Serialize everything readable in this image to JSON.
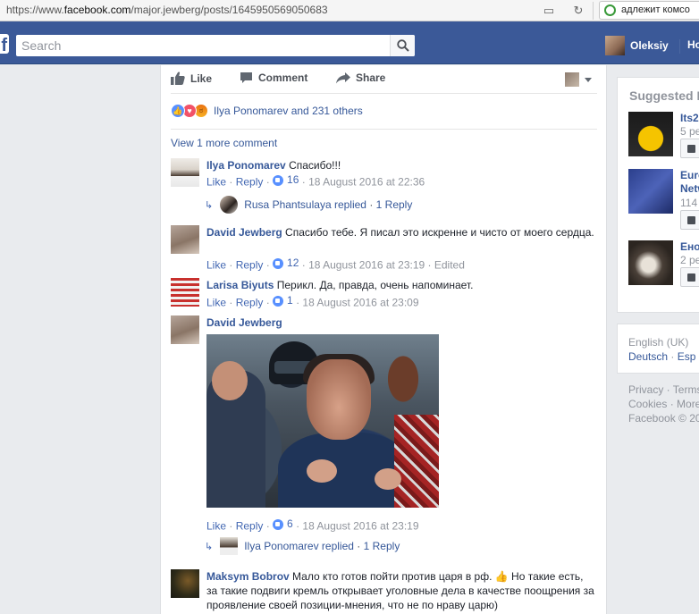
{
  "browser": {
    "url_prefix": "https://www.",
    "url_host": "facebook.com",
    "url_path": "/major.jewberg/posts/1645950569050683",
    "search_text": "адлежит комсо"
  },
  "topbar": {
    "search_placeholder": "Search",
    "user_name": "Oleksiy",
    "home_label": "Ho"
  },
  "post": {
    "actions": {
      "like": "Like",
      "comment": "Comment",
      "share": "Share"
    },
    "reactions_text": "Ilya Ponomarev and 231 others",
    "more_comments": "View 1 more comment"
  },
  "comments": [
    {
      "author": "Ilya Ponomarev",
      "text": "Спасибо!!!",
      "like": "Like",
      "reply": "Reply",
      "likes": "16",
      "time": "18 August 2016 at 22:36",
      "reply_author": "Rusa Phantsulaya replied",
      "reply_count": "1 Reply"
    },
    {
      "author": "David Jewberg",
      "text": "Спасибо тебе. Я писал это искренне и чисто от моего сердца.",
      "like": "Like",
      "reply": "Reply",
      "likes": "12",
      "time": "18 August 2016 at 23:19",
      "edited": "Edited"
    },
    {
      "author": "Larisa Biyuts",
      "text": "Перикл. Да, правда, очень напоминает.",
      "like": "Like",
      "reply": "Reply",
      "likes": "1",
      "time": "18 August 2016 at 23:09"
    },
    {
      "author": "David Jewberg",
      "like": "Like",
      "reply": "Reply",
      "likes": "6",
      "time": "18 August 2016 at 23:19",
      "reply_author": "Ilya Ponomarev replied",
      "reply_count": "1 Reply"
    },
    {
      "author": "Maksym Bobrov",
      "text": "Мало кто готов пойти против царя в рф. 👍 Но такие есть, за такие подвиги кремль открывает уголовные дела в качестве поощрения за проявление своей позиции-мнения, что не по нраву царю)"
    }
  ],
  "sidebar": {
    "title": "Suggested P",
    "suggestions": [
      {
        "name": "Its2",
        "meta": "5 pe"
      },
      {
        "name": "Euro",
        "name2": "Netw",
        "meta": "114"
      },
      {
        "name": "Енот",
        "meta": "2 pe"
      }
    ],
    "languages": {
      "current": "English (UK)",
      "sep": "·",
      "de": "Deutsch",
      "sep2": "·",
      "es": "Esp"
    },
    "footer": {
      "privacy": "Privacy · Terms",
      "cookies": "Cookies · More",
      "copyright": "Facebook © 20"
    }
  },
  "colors": {
    "fb_blue": "#3b5998",
    "link": "#365899",
    "meta": "#90949c"
  }
}
